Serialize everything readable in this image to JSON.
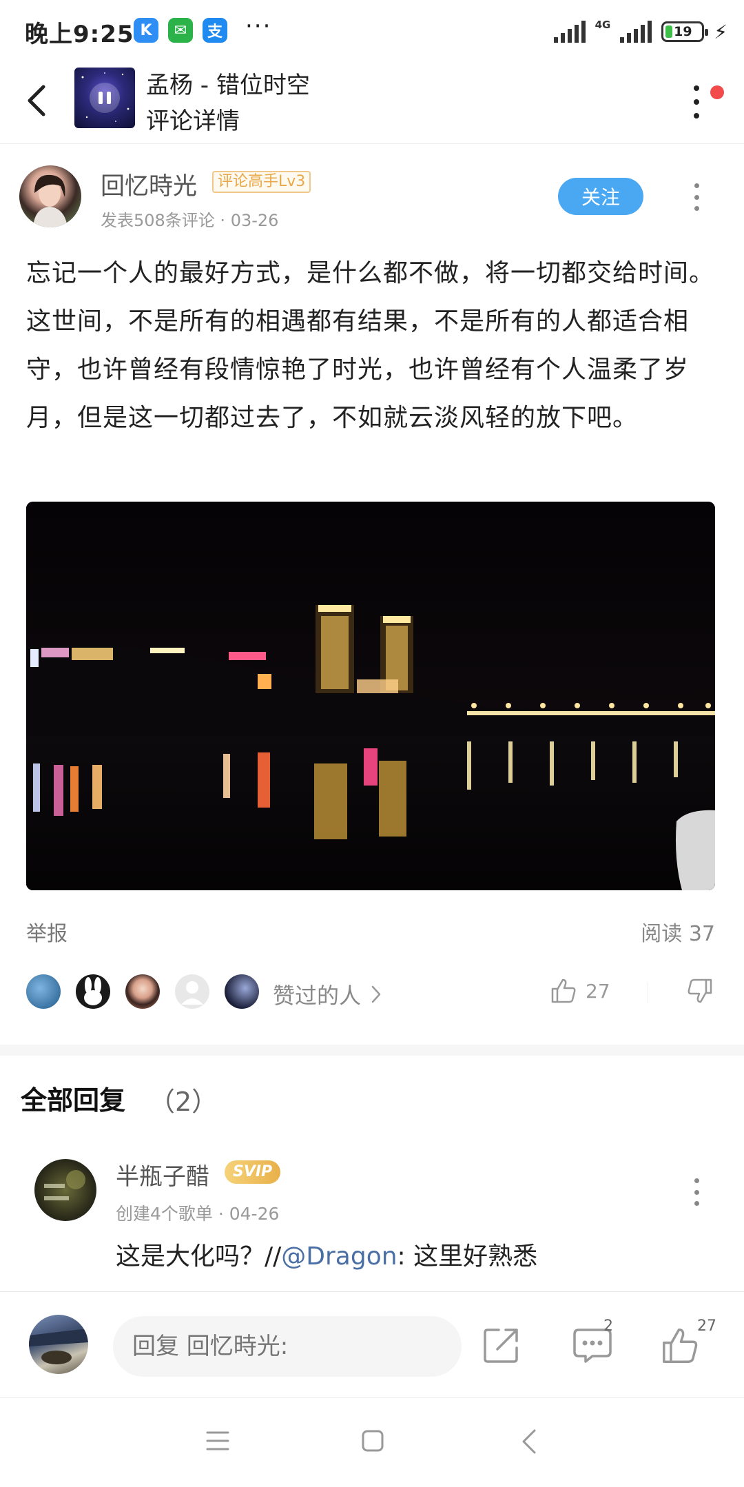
{
  "status_bar": {
    "time": "晚上9:25",
    "dots": "···",
    "network": "4G",
    "battery": "19",
    "battery_level_percent": 19,
    "apps": [
      {
        "icon": "kugou-icon",
        "glyph": "K",
        "color": "#2f8ef4"
      },
      {
        "icon": "wechat-icon",
        "glyph": "✉",
        "color": "#2bb34a"
      },
      {
        "icon": "alipay-icon",
        "glyph": "支",
        "color": "#1f8af0"
      }
    ]
  },
  "header": {
    "song_title": "孟杨 - 错位时空",
    "page_title": "评论详情"
  },
  "post": {
    "author": "回忆時光",
    "level_badge": "评论高手Lv3",
    "meta": "发表508条评论 · 03-26",
    "follow_label": "关注",
    "text": "忘记一个人的最好方式，是什么都不做，将一切都交给时间。这世间，不是所有的相遇都有结果，不是所有的人都适合相守，也许曾经有段情惊艳了时光，也许曾经有个人温柔了岁月，但是这一切都过去了，不如就云淡风轻的放下吧。",
    "report_label": "举报",
    "read_label": "阅读 37",
    "likers_label": "赞过的人",
    "like_count": "27"
  },
  "replies": {
    "title": "全部回复",
    "count": "（2）",
    "items": [
      {
        "name": "半瓶子醋",
        "badge": "SVIP",
        "meta": "创建4个歌单 · 04-26",
        "text_prefix": "这是大化吗？//",
        "mention": "@Dragon",
        "text_suffix": ": 这里好熟悉"
      }
    ]
  },
  "bottom_bar": {
    "reply_placeholder": "回复 回忆時光:",
    "comment_count": "2",
    "like_count": "27"
  },
  "colors": {
    "accent_blue": "#4aa8f3",
    "badge_gold": "#e8a84a",
    "mention_blue": "#4a6fa5",
    "notification_red": "#f24b4b"
  }
}
